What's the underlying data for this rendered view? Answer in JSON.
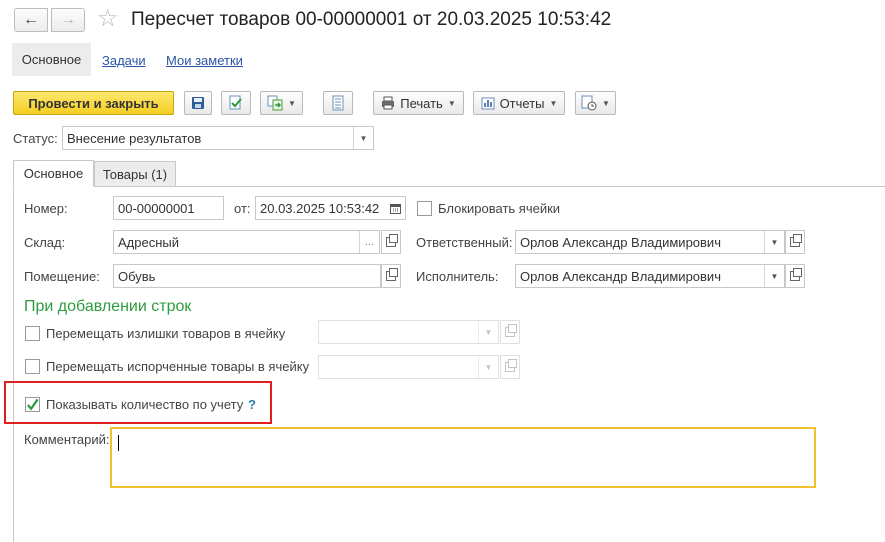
{
  "window": {
    "title": "Пересчет товаров 00-00000001 от 20.03.2025 10:53:42",
    "nav_back": "←",
    "nav_forward": "→",
    "star": "☆"
  },
  "section_tabs": {
    "main": "Основное",
    "tasks": "Задачи",
    "notes": "Мои заметки"
  },
  "toolbar": {
    "post_close": "Провести и закрыть",
    "print": "Печать",
    "reports": "Отчеты"
  },
  "status": {
    "label": "Статус:",
    "value": "Внесение результатов"
  },
  "form_tabs": {
    "main": "Основное",
    "goods": "Товары (1)"
  },
  "fields": {
    "number_label": "Номер:",
    "number_value": "00-00000001",
    "date_label": "от:",
    "date_value": "20.03.2025 10:53:42",
    "block_cells_label": "Блокировать ячейки",
    "warehouse_label": "Склад:",
    "warehouse_value": "Адресный",
    "responsible_label": "Ответственный:",
    "responsible_value": "Орлов Александр Владимирович",
    "room_label": "Помещение:",
    "room_value": "Обувь",
    "executor_label": "Исполнитель:",
    "executor_value": "Орлов Александр Владимирович",
    "ellipsis": "..."
  },
  "add_rows": {
    "heading": "При добавлении строк",
    "move_surplus_label": "Перемещать излишки товаров в ячейку",
    "move_spoiled_label": "Перемещать испорченные товары в ячейку",
    "show_qty_label": "Показывать количество по учету",
    "help": "?"
  },
  "comment": {
    "label": "Комментарий:",
    "value": ""
  },
  "colors": {
    "accent_yellow": "#f4cf21",
    "heading_green": "#2e9b3e",
    "highlight_red": "#e02020",
    "focus_border": "#f0c030",
    "link_blue": "#2a55a6"
  }
}
